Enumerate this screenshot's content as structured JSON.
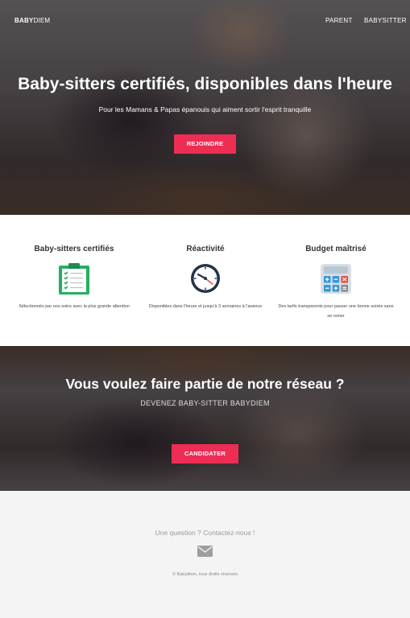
{
  "nav": {
    "logo_bold": "BABY",
    "logo_light": "DIEM",
    "links": [
      "PARENT",
      "BABYSITTER"
    ]
  },
  "hero": {
    "title": "Baby-sitters certifiés, disponibles dans l'heure",
    "subtitle": "Pour les Mamans & Papas épanouis qui aiment sortir l'esprit tranquille",
    "cta": "REJOINDRE"
  },
  "features": [
    {
      "title": "Baby-sitters certifiés",
      "icon": "clipboard-check-icon",
      "description": "Sélectionnés par nos soins avec la plus grande attention"
    },
    {
      "title": "Réactivité",
      "icon": "clock-icon",
      "description": "Disponibles dans l'heure et jusqu'à 3 semaines à l'avance"
    },
    {
      "title": "Budget maîtrisé",
      "icon": "calculator-icon",
      "description": "Des tarifs transparents pour passer une bonne soirée sans se ruiner"
    }
  ],
  "banner": {
    "title": "Vous voulez faire partie de notre réseau ?",
    "subtitle": "DEVENEZ BABY-SITTER BABYDIEM",
    "cta": "CANDIDATER"
  },
  "footer": {
    "contact": "Une question ? Contactez-nous !",
    "mail_icon": "envelope-icon",
    "copyright": "© Babydiem, tous droits réservés"
  },
  "colors": {
    "accent": "#ee2d55",
    "clipboard_green": "#27ae60",
    "clock_navy": "#233247"
  }
}
